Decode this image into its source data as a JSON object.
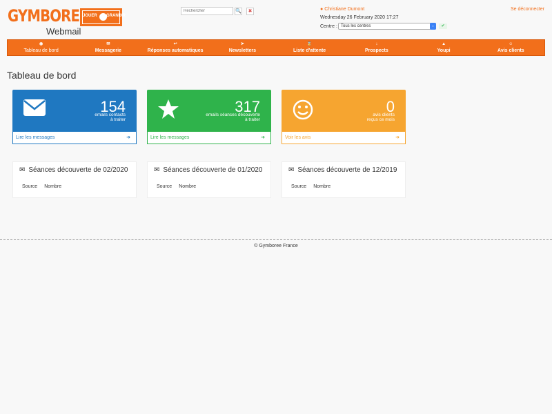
{
  "brand": {
    "logo_word": "GYMBOREE",
    "badge_left": "JOUER",
    "badge_right": "GRANDIR",
    "subtitle": "Webmail",
    "accent": "#f26f1b"
  },
  "search": {
    "placeholder": "Rechercher"
  },
  "user": {
    "name": "Christiane Dumont",
    "datetime": "Wednesday 26 February 2020 17:27",
    "centre_label": "Centre :",
    "centre_value": "Tous les centres",
    "logout": "Se déconnecter"
  },
  "nav": {
    "items": [
      {
        "label": "Tableau de bord",
        "icon": "dashboard-icon"
      },
      {
        "label": "Messagerie",
        "icon": "envelope-icon"
      },
      {
        "label": "Réponses automatiques",
        "icon": "reply-icon"
      },
      {
        "label": "Newsletters",
        "icon": "paper-plane-icon"
      },
      {
        "label": "Liste d'attente",
        "icon": "hourglass-icon"
      },
      {
        "label": "Prospects",
        "icon": "arrow-down-icon"
      },
      {
        "label": "Youpi",
        "icon": "trophy-icon"
      },
      {
        "label": "Avis clients",
        "icon": "smile-icon"
      }
    ]
  },
  "page": {
    "title": "Tableau de bord"
  },
  "cards": [
    {
      "value": "154",
      "desc": "emails contacts\nà traiter",
      "link": "Lire les messages",
      "icon": "envelope-icon",
      "color": "#1f78c1"
    },
    {
      "value": "317",
      "desc": "emails séances découverte\nà traiter",
      "link": "Lire les messages",
      "icon": "star-icon",
      "color": "#2fb34b"
    },
    {
      "value": "0",
      "desc": "avis clients\nreçus ce mois",
      "link": "Voir les avis",
      "icon": "smile-icon",
      "color": "#f6a530"
    }
  ],
  "panels": [
    {
      "title": "Séances découverte de 02/2020",
      "col1": "Source",
      "col2": "Nombre"
    },
    {
      "title": "Séances découverte de 01/2020",
      "col1": "Source",
      "col2": "Nombre"
    },
    {
      "title": "Séances découverte de 12/2019",
      "col1": "Source",
      "col2": "Nombre"
    }
  ],
  "footer": {
    "text": "© Gymboree France"
  }
}
